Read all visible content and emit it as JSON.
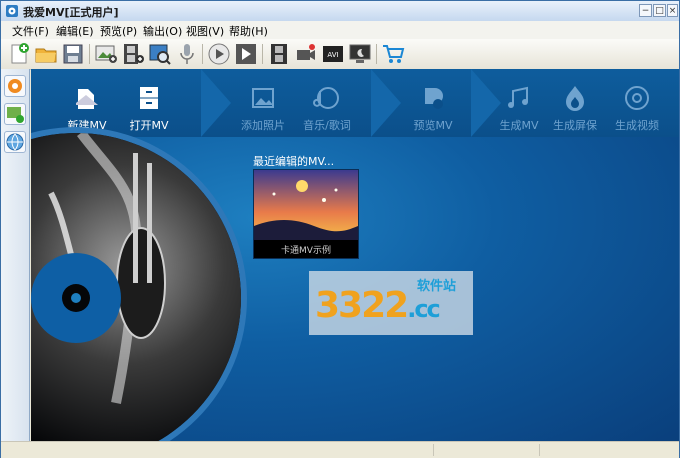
{
  "window": {
    "title": "我爱MV[正式用户]"
  },
  "window_controls": {
    "minimize": "−",
    "maximize": "□",
    "close": "×"
  },
  "menu": [
    "文件(F)",
    "编辑(E)",
    "预览(P)",
    "输出(O)",
    "视图(V)",
    "帮助(H)"
  ],
  "nav": {
    "new_mv": "新建MV",
    "open_mv": "打开MV",
    "add_photos": "添加照片",
    "music_lyrics": "音乐/歌词",
    "preview_mv": "预览MV",
    "generate_mv": "生成MV",
    "generate_screensaver": "生成屏保",
    "generate_video": "生成视频"
  },
  "recent": {
    "title": "最近编辑的MV...",
    "items": [
      {
        "caption": "卡通MV示例"
      }
    ]
  },
  "watermark": {
    "number": "3322",
    "domain": ".cc",
    "tag": "软件站"
  },
  "toolbar_icons": [
    "new-project-icon",
    "open-folder-icon",
    "save-icon",
    "add-photo-icon",
    "add-film-icon",
    "zoom-photo-icon",
    "microphone-icon",
    "play-icon",
    "play-next-icon",
    "filmstrip-icon",
    "camera-icon",
    "avi-icon",
    "screensaver-icon",
    "cart-icon"
  ],
  "toolbar_avi_label": "AVI",
  "colors": {
    "accent": "#1e7fc0",
    "nav_dark": "#0b4f8a",
    "nav_off": "#6fa3cf"
  }
}
